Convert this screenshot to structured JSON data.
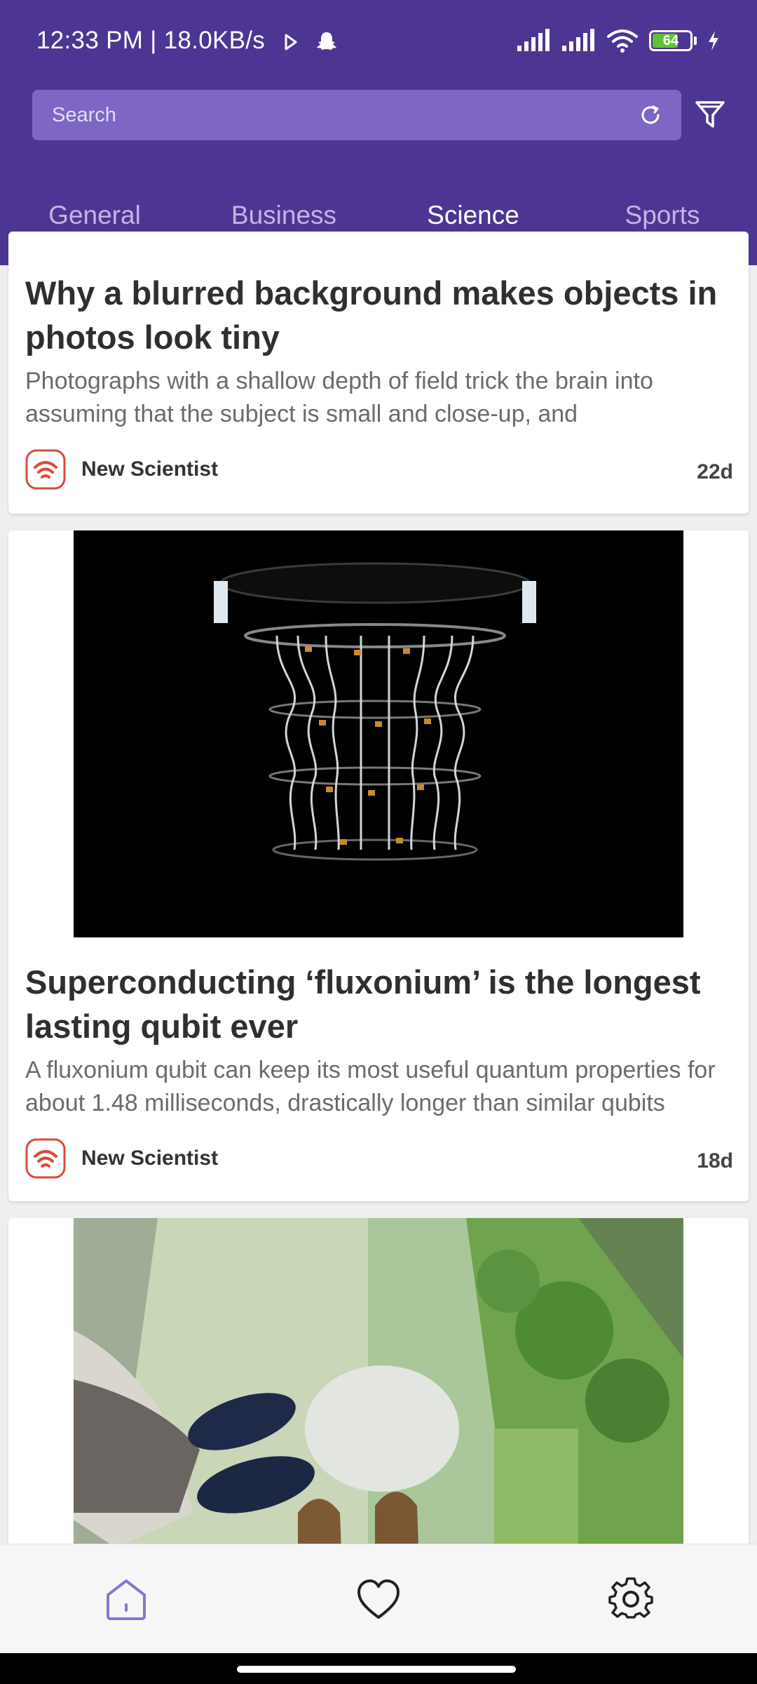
{
  "status_bar": {
    "text": "12:33 PM | 18.0KB/s",
    "battery": "64"
  },
  "search": {
    "placeholder": "Search"
  },
  "tabs": [
    {
      "label": "General",
      "active": false
    },
    {
      "label": "Business",
      "active": false
    },
    {
      "label": "Science",
      "active": true
    },
    {
      "label": "Sports",
      "active": false
    }
  ],
  "articles": [
    {
      "title": "Why a blurred background makes objects in photos look tiny",
      "description": "Photographs with a shallow depth of field trick the brain into assuming that the subject is small and close-up, and",
      "source": "New Scientist",
      "age": "22d"
    },
    {
      "title": "Superconducting ‘fluxonium’ is the longest lasting qubit ever",
      "description": "A fluxonium qubit can keep its most useful quantum properties for about 1.48 milliseconds, drastically longer than similar qubits",
      "source": "New Scientist",
      "age": "18d"
    }
  ],
  "icons": {
    "refresh": "refresh-icon",
    "filter": "filter-icon",
    "home": "home-icon",
    "favorites": "heart-icon",
    "settings": "gear-icon",
    "source_logo": "rss-icon"
  },
  "colors": {
    "header": "#4d3693",
    "search_bg": "#7d66c4",
    "tab_indicator": "#e2544a",
    "source_accent": "#d94a3d",
    "nav_active": "#8a74d0"
  }
}
